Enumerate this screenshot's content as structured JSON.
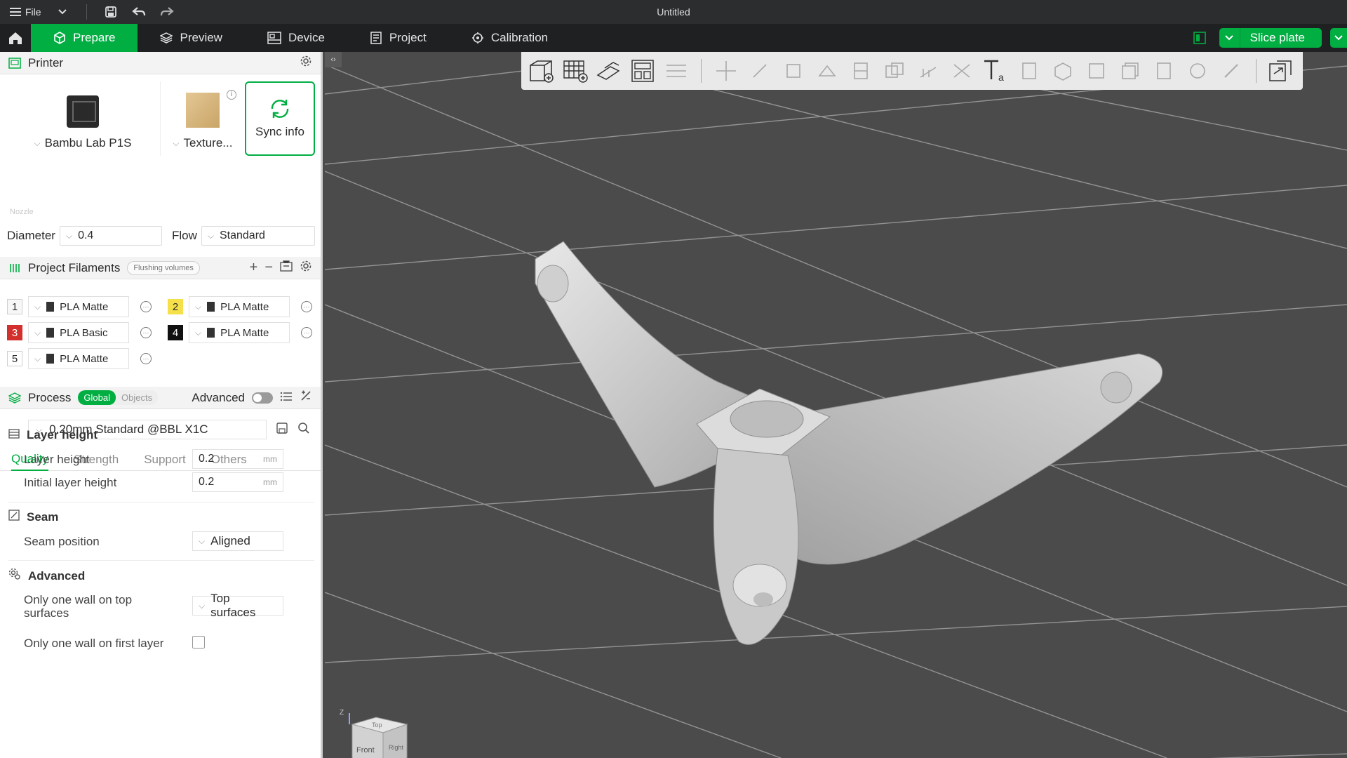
{
  "titlebar": {
    "menu_label": "File",
    "title": "Untitled"
  },
  "nav": {
    "tabs": [
      {
        "label": "Prepare",
        "icon": "cube-icon",
        "active": true
      },
      {
        "label": "Preview",
        "icon": "layers-icon",
        "active": false
      },
      {
        "label": "Device",
        "icon": "device-icon",
        "active": false
      },
      {
        "label": "Project",
        "icon": "project-icon",
        "active": false
      },
      {
        "label": "Calibration",
        "icon": "calibration-icon",
        "active": false
      }
    ],
    "slice_label": "Slice plate"
  },
  "printer": {
    "section_title": "Printer",
    "printer_name": "Bambu Lab P1S",
    "plate_label": "Texture...",
    "sync_label": "Sync info",
    "nozzle_label": "Nozzle",
    "diameter_label": "Diameter",
    "diameter_value": "0.4",
    "flow_label": "Flow",
    "flow_value": "Standard"
  },
  "filaments": {
    "section_title": "Project Filaments",
    "flushing_label": "Flushing volumes",
    "items": [
      {
        "num": "1",
        "name": "PLA Matte",
        "color": "#f2f2f2"
      },
      {
        "num": "2",
        "name": "PLA Matte",
        "color": "#f5e04a"
      },
      {
        "num": "3",
        "name": "PLA Basic",
        "color": "#d2302c"
      },
      {
        "num": "4",
        "name": "PLA Matte",
        "color": "#111111"
      },
      {
        "num": "5",
        "name": "PLA Matte",
        "color": "#ffffff"
      }
    ]
  },
  "process": {
    "section_title": "Process",
    "seg_global": "Global",
    "seg_objects": "Objects",
    "advanced_label": "Advanced",
    "preset": "0.20mm Standard @BBL X1C",
    "tabs": [
      "Quality",
      "Strength",
      "Support",
      "Others"
    ],
    "groups": {
      "layer_height": {
        "title": "Layer height",
        "layer_height_label": "Layer height",
        "layer_height_value": "0.2",
        "initial_label": "Initial layer height",
        "initial_value": "0.2",
        "unit": "mm"
      },
      "seam": {
        "title": "Seam",
        "position_label": "Seam position",
        "position_value": "Aligned"
      },
      "advanced": {
        "title": "Advanced",
        "one_wall_top_label_line1": "Only one wall on top",
        "one_wall_top_label_line2": "surfaces",
        "one_wall_top_value": "Top surfaces",
        "one_wall_first_label": "Only one wall on first layer",
        "one_wall_first_checked": false
      }
    }
  },
  "viewport": {
    "navcube": {
      "z_label": "Z",
      "top_label": "Top",
      "front_label": "Front",
      "right_label": "Right"
    }
  },
  "colors": {
    "accent": "#00ae42",
    "titlebar": "#2b2d2f",
    "navbar": "#1f2022",
    "viewport": "#4b4b4c"
  }
}
